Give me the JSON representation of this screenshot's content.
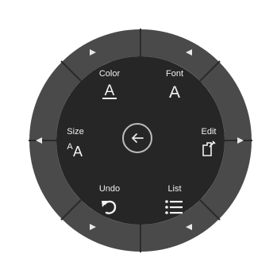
{
  "radial_menu": {
    "items": {
      "color": {
        "label": "Color",
        "icon": "font-color-icon"
      },
      "font": {
        "label": "Font",
        "icon": "font-icon"
      },
      "size": {
        "label": "Size",
        "icon": "font-size-icon"
      },
      "edit": {
        "label": "Edit",
        "icon": "edit-icon"
      },
      "undo": {
        "label": "Undo",
        "icon": "undo-icon"
      },
      "list": {
        "label": "List",
        "icon": "list-icon"
      }
    },
    "center": {
      "icon": "back-arrow-icon"
    },
    "colors": {
      "outer_ring": "#4a4a4a",
      "inner_disc": "#262626",
      "text": "#f0f0f0",
      "center_ring": "#bdbdbd"
    }
  }
}
